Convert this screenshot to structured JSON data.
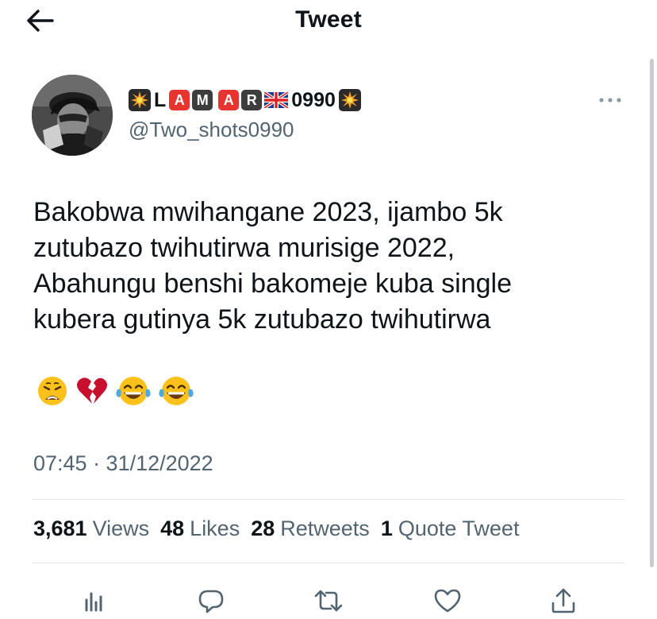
{
  "header": {
    "title": "Tweet",
    "back_icon": "arrow-left-icon"
  },
  "author": {
    "display_name_parts": [
      "💥",
      "L",
      "🅰",
      "M",
      "🅰",
      "R",
      "🇬🇧",
      "0990",
      "💥"
    ],
    "display_name_letters": {
      "l": "L",
      "a1": "A",
      "m": "M",
      "a2": "A",
      "r": "R",
      "digits": "0990"
    },
    "handle": "@Two_shots0990"
  },
  "tweet": {
    "lines": [
      "Bakobwa mwihangane 2023, ijambo 5k",
      "zutubazo twihutirwa murisige 2022,",
      "Abahungu benshi bakomeje kuba single",
      "kubera gutinya 5k zutubazo twihutirwa"
    ],
    "emojis": [
      "weary-face",
      "broken-heart",
      "face-with-tears-of-joy",
      "face-with-tears-of-joy"
    ],
    "timestamp": "07:45 · 31/12/2022"
  },
  "stats": [
    {
      "count": "3,681",
      "label": "Views"
    },
    {
      "count": "48",
      "label": "Likes"
    },
    {
      "count": "28",
      "label": "Retweets"
    },
    {
      "count": "1",
      "label": "Quote Tweet"
    }
  ],
  "actions": [
    "analytics-icon",
    "reply-icon",
    "retweet-icon",
    "like-icon",
    "share-icon"
  ],
  "colors": {
    "text": "#0f1419",
    "secondary": "#536471",
    "divider": "#e6e9eb",
    "emoji_red": "#e8342e"
  }
}
